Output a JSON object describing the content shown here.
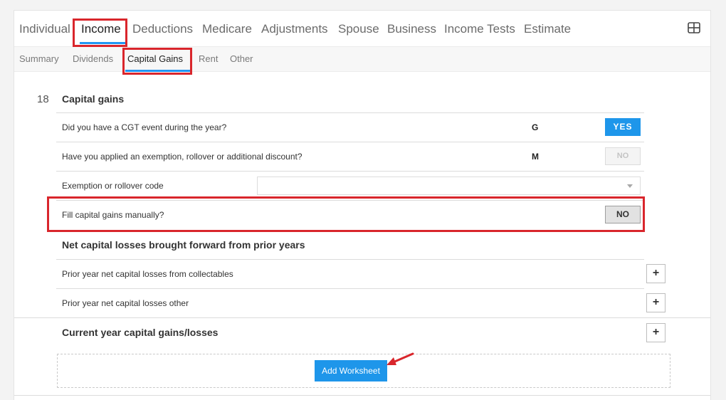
{
  "main_tabs": [
    {
      "label": "Individual",
      "active": false
    },
    {
      "label": "Income",
      "active": true
    },
    {
      "label": "Deductions",
      "active": false
    },
    {
      "label": "Medicare",
      "active": false
    },
    {
      "label": "Adjustments",
      "active": false
    },
    {
      "label": "Spouse",
      "active": false
    },
    {
      "label": "Business",
      "active": false
    },
    {
      "label": "Income Tests",
      "active": false
    },
    {
      "label": "Estimate",
      "active": false
    }
  ],
  "sub_tabs": [
    {
      "label": "Summary",
      "active": false
    },
    {
      "label": "Dividends",
      "active": false
    },
    {
      "label": "Capital Gains",
      "active": true
    },
    {
      "label": "Rent",
      "active": false
    },
    {
      "label": "Other",
      "active": false
    }
  ],
  "section": {
    "number": "18",
    "title": "Capital gains",
    "rows": [
      {
        "label": "Did you have a CGT event during the year?",
        "code": "G",
        "button": "YES"
      },
      {
        "label": "Have you applied an exemption, rollover or additional discount?",
        "code": "M",
        "button": "NO"
      },
      {
        "label": "Exemption or rollover code",
        "select_value": ""
      },
      {
        "label": "Fill capital gains manually?",
        "button": "NO"
      }
    ]
  },
  "losses": {
    "title": "Net capital losses brought forward from prior years",
    "rows": [
      {
        "label": "Prior year net capital losses from collectables",
        "button": "+"
      },
      {
        "label": "Prior year net capital losses other",
        "button": "+"
      }
    ]
  },
  "current_year": {
    "title": "Current year capital gains/losses",
    "button": "+",
    "worksheet_button": "Add Worksheet"
  },
  "colors": {
    "accent": "#2196f3",
    "primary_button": "#1e96ea",
    "highlight": "#d9262c"
  }
}
